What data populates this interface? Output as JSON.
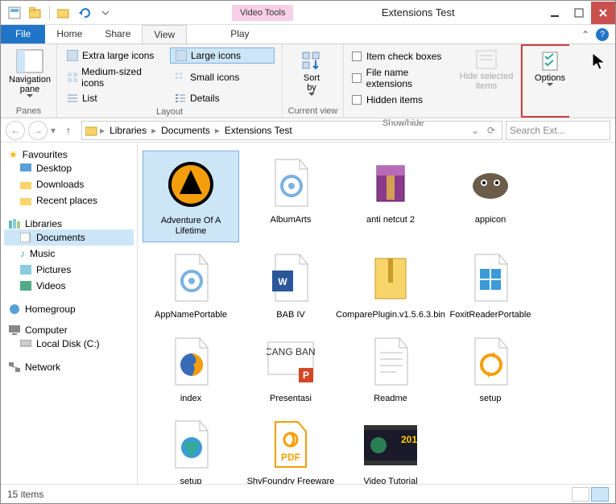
{
  "title": "Extensions Test",
  "toolTab": "Video Tools",
  "tabs": {
    "file": "File",
    "home": "Home",
    "share": "Share",
    "view": "View",
    "play": "Play"
  },
  "ribbon": {
    "panes": {
      "nav": "Navigation\npane",
      "label": "Panes"
    },
    "layout": {
      "xl": "Extra large icons",
      "l": "Large icons",
      "m": "Medium-sized icons",
      "s": "Small icons",
      "list": "List",
      "details": "Details",
      "label": "Layout"
    },
    "current": {
      "sort": "Sort\nby",
      "label": "Current view"
    },
    "showhide": {
      "chk1": "Item check boxes",
      "chk2": "File name extensions",
      "chk3": "Hidden items",
      "hide": "Hide selected\nitems",
      "label": "Show/hide"
    },
    "options": "Options"
  },
  "breadcrumb": [
    "Libraries",
    "Documents",
    "Extensions Test"
  ],
  "searchPlaceholder": "Search Ext...",
  "sidebar": {
    "favourites": "Favourites",
    "desktop": "Desktop",
    "downloads": "Downloads",
    "recent": "Recent places",
    "libraries": "Libraries",
    "documents": "Documents",
    "music": "Music",
    "pictures": "Pictures",
    "videos": "Videos",
    "homegroup": "Homegroup",
    "computer": "Computer",
    "localdisk": "Local Disk (C:)",
    "network": "Network"
  },
  "files": [
    {
      "name": "Adventure Of A Lifetime",
      "icon": "aimp"
    },
    {
      "name": "AlbumArts",
      "icon": "gear-doc"
    },
    {
      "name": "anti netcut 2",
      "icon": "rar"
    },
    {
      "name": "appicon",
      "icon": "gimp"
    },
    {
      "name": "AppNamePortable",
      "icon": "gear-doc"
    },
    {
      "name": "BAB IV",
      "icon": "word"
    },
    {
      "name": "ComparePlugin.v1.5.6.3.bin",
      "icon": "zip"
    },
    {
      "name": "FoxitReaderPortable",
      "icon": "foxit-exe"
    },
    {
      "name": "index",
      "icon": "firefox"
    },
    {
      "name": "Presentasi",
      "icon": "ppt"
    },
    {
      "name": "Readme",
      "icon": "text"
    },
    {
      "name": "setup",
      "icon": "sync"
    },
    {
      "name": "setup",
      "icon": "globe"
    },
    {
      "name": "ShyFoundry Freeware EULA",
      "icon": "pdf"
    },
    {
      "name": "Video Tutorial",
      "icon": "video"
    }
  ],
  "status": "15 items"
}
